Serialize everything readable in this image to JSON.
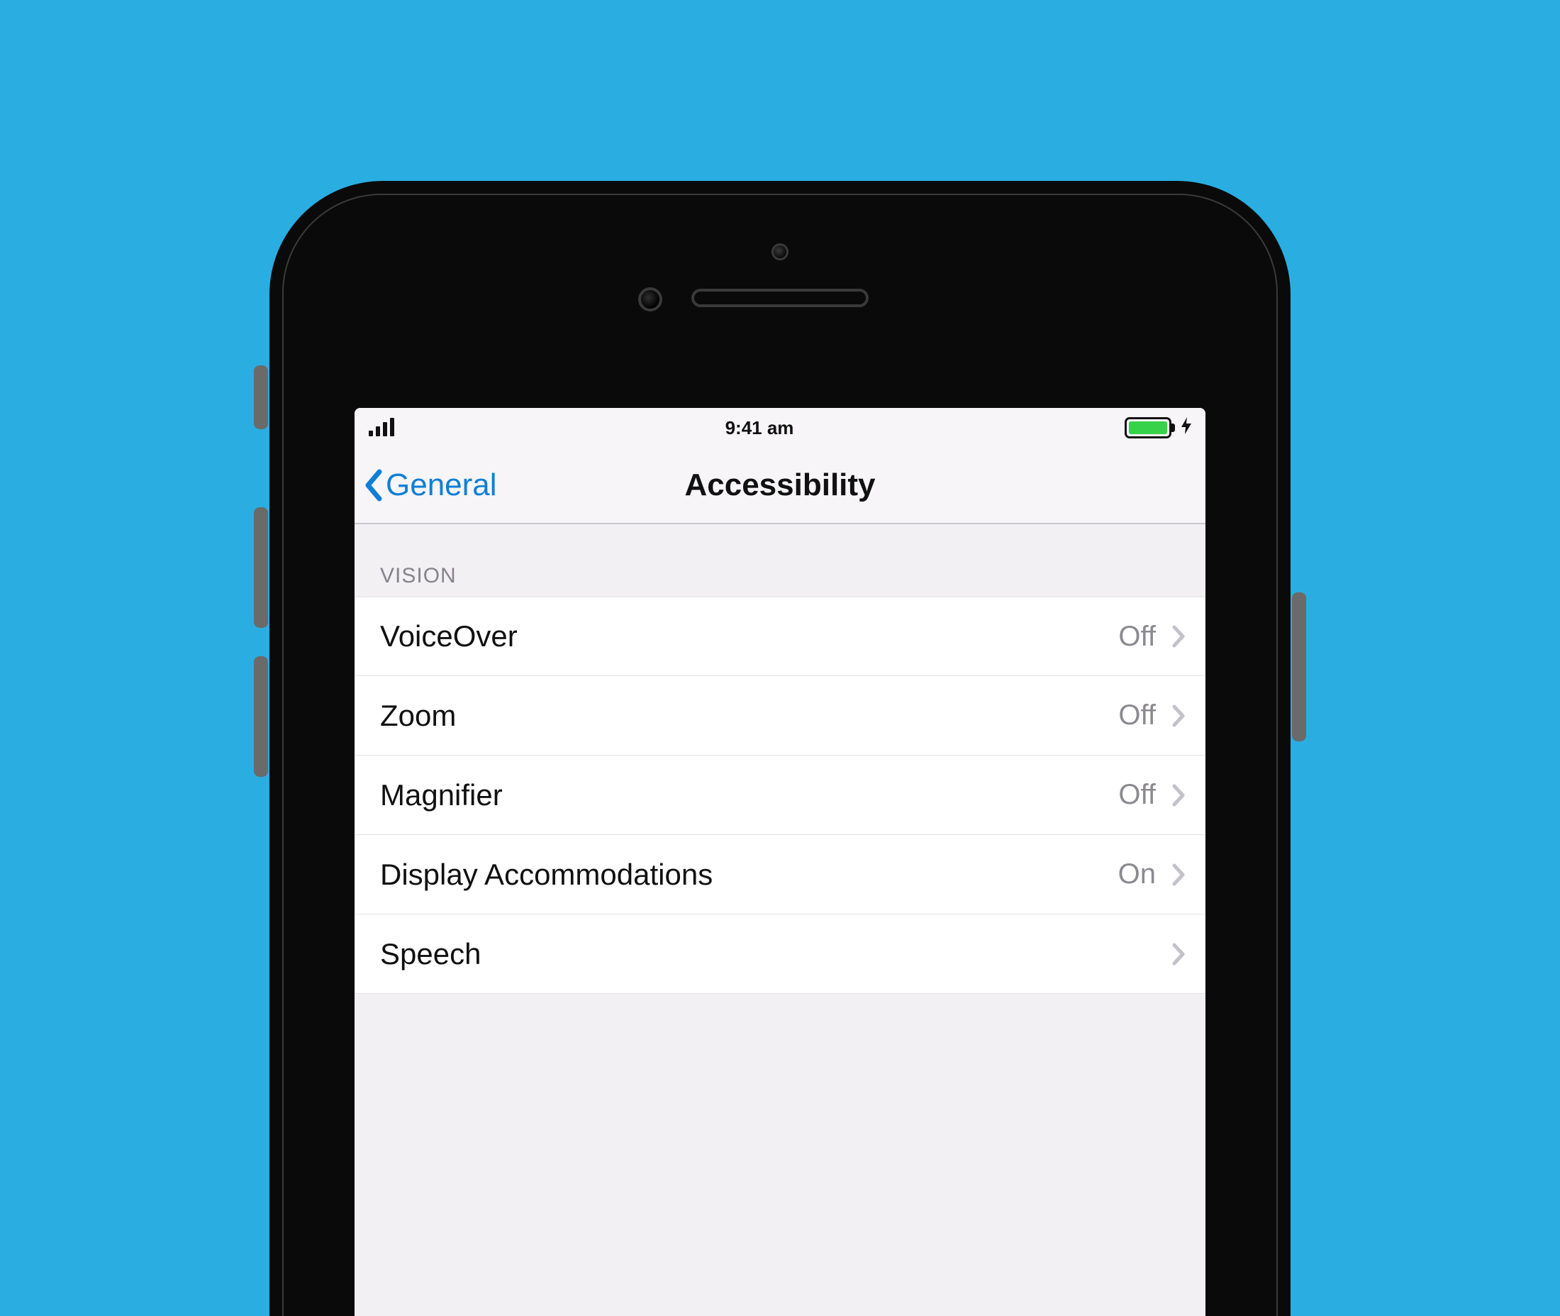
{
  "status": {
    "time": "9:41 am"
  },
  "nav": {
    "back_label": "General",
    "title": "Accessibility"
  },
  "section_header": "VISION",
  "rows": [
    {
      "label": "VoiceOver",
      "value": "Off"
    },
    {
      "label": "Zoom",
      "value": "Off"
    },
    {
      "label": "Magnifier",
      "value": "Off"
    },
    {
      "label": "Display Accommodations",
      "value": "On"
    },
    {
      "label": "Speech",
      "value": ""
    }
  ]
}
